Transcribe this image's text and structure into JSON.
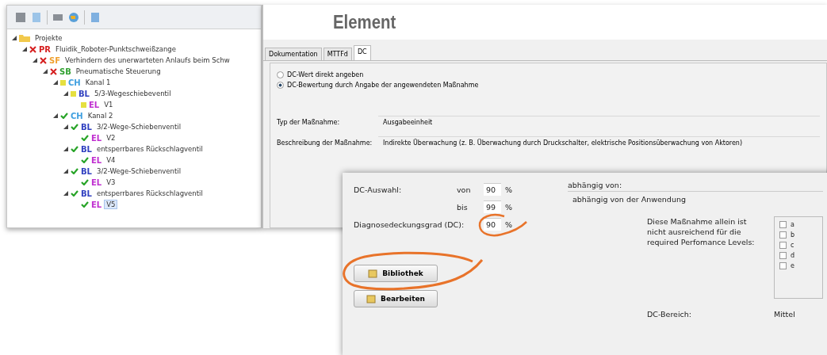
{
  "tree": {
    "nodes": [
      {
        "label": "Projekte",
        "kind": "folder",
        "expanded": true,
        "selected": false,
        "children": [
          {
            "code": "PR",
            "label": "Fluidik_Roboter-Punktschweißzange",
            "kind": "fail",
            "color": "#d62020",
            "expanded": true,
            "selected": false,
            "children": [
              {
                "code": "SF",
                "label": "Verhindern des unerwarteten Anlaufs beim Schw",
                "kind": "fail",
                "color": "#f0a030",
                "expanded": true,
                "selected": false,
                "children": [
                  {
                    "code": "SB",
                    "label": "Pneumatische Steuerung",
                    "kind": "fail",
                    "color": "#30a030",
                    "expanded": true,
                    "selected": false,
                    "children": [
                      {
                        "code": "CH",
                        "label": "Kanal 1",
                        "kind": "partial",
                        "color": "#40a0e0",
                        "expanded": true,
                        "selected": false,
                        "children": [
                          {
                            "code": "BL",
                            "label": "5/3-Wegeschiebeventil",
                            "kind": "partial",
                            "color": "#3040c0",
                            "expanded": true,
                            "selected": false,
                            "children": [
                              {
                                "code": "EL",
                                "label": "V1",
                                "kind": "partial",
                                "color": "#c030d0",
                                "selected": false
                              }
                            ]
                          }
                        ]
                      },
                      {
                        "code": "CH",
                        "label": "Kanal 2",
                        "kind": "ok",
                        "color": "#40a0e0",
                        "expanded": true,
                        "selected": false,
                        "children": [
                          {
                            "code": "BL",
                            "label": "3/2-Wege-Schiebenventil",
                            "kind": "ok",
                            "color": "#3040c0",
                            "expanded": true,
                            "selected": false,
                            "children": [
                              {
                                "code": "EL",
                                "label": "V2",
                                "kind": "ok",
                                "color": "#c030d0",
                                "selected": false
                              }
                            ]
                          },
                          {
                            "code": "BL",
                            "label": "entsperrbares Rückschlagventil",
                            "kind": "ok",
                            "color": "#3040c0",
                            "expanded": true,
                            "selected": false,
                            "children": [
                              {
                                "code": "EL",
                                "label": "V4",
                                "kind": "ok",
                                "color": "#c030d0",
                                "selected": false
                              }
                            ]
                          },
                          {
                            "code": "BL",
                            "label": "3/2-Wege-Schiebenventil",
                            "kind": "ok",
                            "color": "#3040c0",
                            "expanded": true,
                            "selected": false,
                            "children": [
                              {
                                "code": "EL",
                                "label": "V3",
                                "kind": "ok",
                                "color": "#c030d0",
                                "selected": false
                              }
                            ]
                          },
                          {
                            "code": "BL",
                            "label": "entsperrbares Rückschlagventil",
                            "kind": "ok",
                            "color": "#3040c0",
                            "expanded": true,
                            "selected": false,
                            "children": [
                              {
                                "code": "EL",
                                "label": "V5",
                                "kind": "ok",
                                "color": "#c030d0",
                                "selected": true
                              }
                            ]
                          }
                        ]
                      }
                    ]
                  }
                ]
              }
            ]
          }
        ]
      }
    ]
  },
  "main": {
    "title": "Element",
    "tabs": [
      {
        "label": "Dokumentation",
        "selected": false
      },
      {
        "label": "MTTFd",
        "selected": false
      },
      {
        "label": "DC",
        "selected": true
      }
    ],
    "radios": [
      {
        "label": "DC-Wert direkt angeben",
        "selected": false
      },
      {
        "label": "DC-Bewertung durch Angabe der angewendeten Maßnahme",
        "selected": true
      }
    ],
    "fields": [
      {
        "label": "Typ der Maßnahme:",
        "value": "Ausgabeeinheit"
      },
      {
        "label": "Beschreibung der Maßnahme:",
        "value": "Indirekte Überwachung (z. B. Überwachung durch Druckschalter, elektrische Positionsüberwachung von Aktoren)"
      }
    ]
  },
  "detail": {
    "dc_selection": {
      "label": "DC-Auswahl:",
      "from_label": "von",
      "from": "90",
      "to_label": "bis",
      "to": "99",
      "unit_1": "%",
      "unit_2": "%"
    },
    "dc": {
      "label": "Diagnosedeckungsgrad (DC):",
      "value": "90",
      "unit": "%"
    },
    "buttons": [
      "Bibliothek",
      "Bearbeiten"
    ],
    "depends": {
      "label": "abhängig von:",
      "value": "abhängig von der Anwendung"
    },
    "note": "Diese Maßnahme allein ist nicht ausreichend für die required Perfomance Levels:",
    "levels": [
      {
        "label": "a",
        "checked": false
      },
      {
        "label": "b",
        "checked": false
      },
      {
        "label": "c",
        "checked": false
      },
      {
        "label": "d",
        "checked": false
      },
      {
        "label": "e",
        "checked": false
      }
    ],
    "range": {
      "label": "DC-Bereich:",
      "value": "Mittel"
    }
  }
}
